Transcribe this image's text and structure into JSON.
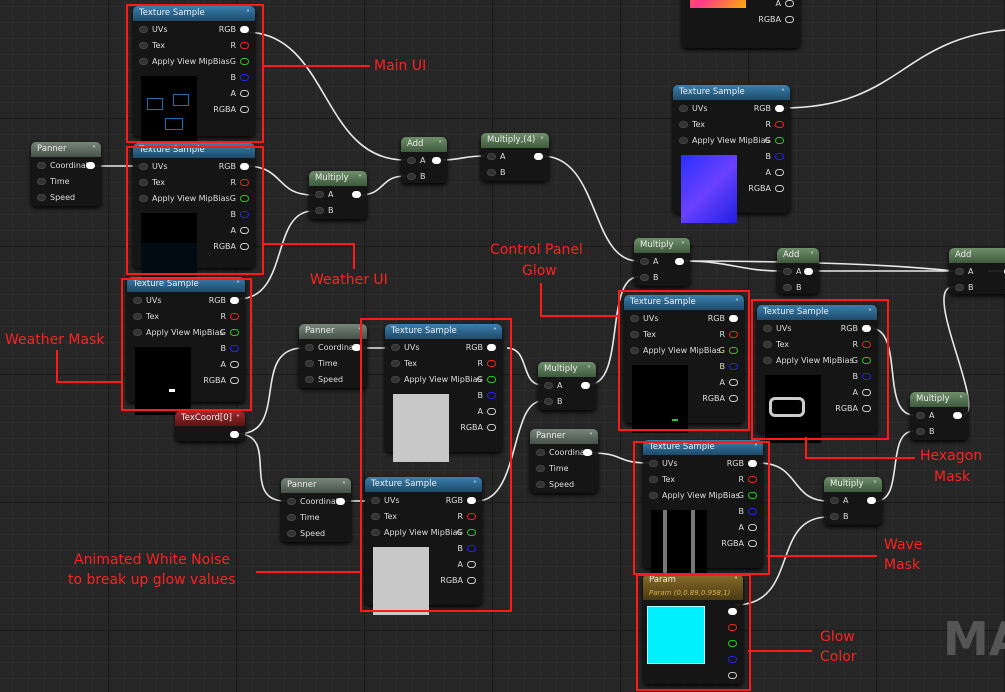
{
  "nodes": [
    {
      "title": "Texture Sample",
      "kind": "tex",
      "inputs": [
        "UVs",
        "Tex",
        "Apply View MipBias"
      ],
      "outputs": [
        "RGB",
        "R",
        "G",
        "B",
        "A",
        "RGBA"
      ],
      "preview": "ui-icons-blue"
    },
    {
      "title": "Texture Sample",
      "kind": "tex",
      "inputs": [
        "UVs",
        "Tex",
        "Apply View MipBias"
      ],
      "outputs": [
        "RGB",
        "R",
        "G",
        "B",
        "A",
        "RGBA"
      ],
      "preview": "dark-blue-panel"
    },
    {
      "title": "Texture Sample",
      "kind": "tex",
      "inputs": [
        "UVs",
        "Tex",
        "Apply View MipBias"
      ],
      "outputs": [
        "RGB",
        "R",
        "G",
        "B",
        "A",
        "RGBA"
      ],
      "preview": "black-white-dash"
    },
    {
      "title": "Panner",
      "kind": "pan",
      "inputs": [
        "Coordinate",
        "Time",
        "Speed"
      ],
      "outputs": [
        ""
      ]
    },
    {
      "title": "Add",
      "kind": "math",
      "inputs": [
        "A",
        "B"
      ],
      "outputs": [
        ""
      ]
    },
    {
      "title": "Multiply,(4)",
      "kind": "math",
      "inputs": [
        "A",
        "B"
      ],
      "outputs": [
        ""
      ]
    },
    {
      "title": "Multiply",
      "kind": "math",
      "inputs": [
        "A",
        "B"
      ],
      "outputs": [
        ""
      ]
    },
    {
      "title": "",
      "kind": "tex",
      "inputs": [],
      "outputs": [
        "A",
        "RGBA"
      ],
      "preview": "orange-texture"
    },
    {
      "title": "Texture Sample",
      "kind": "tex",
      "inputs": [
        "UVs",
        "Tex",
        "Apply View MipBias"
      ],
      "outputs": [
        "RGB",
        "R",
        "G",
        "B",
        "A",
        "RGBA"
      ],
      "preview": "blue-normal-map"
    },
    {
      "title": "Multiply",
      "kind": "math",
      "inputs": [
        "A",
        "B"
      ],
      "outputs": [
        ""
      ]
    },
    {
      "title": "Add",
      "kind": "math",
      "inputs": [
        "A",
        "B"
      ],
      "outputs": [
        ""
      ]
    },
    {
      "title": "Add",
      "kind": "math",
      "inputs": [
        "A",
        "B"
      ],
      "outputs": [
        ""
      ]
    },
    {
      "title": "Texture Sample",
      "kind": "tex",
      "inputs": [
        "UVs",
        "Tex",
        "Apply View MipBias"
      ],
      "outputs": [
        "RGB",
        "R",
        "G",
        "B",
        "A",
        "RGBA"
      ],
      "preview": "black-green-dash"
    },
    {
      "title": "Texture Sample",
      "kind": "tex",
      "inputs": [
        "UVs",
        "Tex",
        "Apply View MipBias"
      ],
      "outputs": [
        "RGB",
        "R",
        "G",
        "B",
        "A",
        "RGBA"
      ],
      "preview": "hexagon-outline"
    },
    {
      "title": "Multiply",
      "kind": "math",
      "inputs": [
        "A",
        "B"
      ],
      "outputs": [
        ""
      ]
    },
    {
      "title": "Panner",
      "kind": "pan",
      "inputs": [
        "Coordinate",
        "Time",
        "Speed"
      ],
      "outputs": [
        ""
      ]
    },
    {
      "title": "Texture Sample",
      "kind": "tex",
      "inputs": [
        "UVs",
        "Tex",
        "Apply View MipBias"
      ],
      "outputs": [
        "RGB",
        "R",
        "G",
        "B",
        "A",
        "RGBA"
      ],
      "preview": "light-grey"
    },
    {
      "title": "Multiply",
      "kind": "math",
      "inputs": [
        "A",
        "B"
      ],
      "outputs": [
        ""
      ]
    },
    {
      "title": "TexCoord[0]",
      "kind": "coord",
      "inputs": [],
      "outputs": [
        ""
      ]
    },
    {
      "title": "Panner",
      "kind": "pan",
      "inputs": [
        "Coordinate",
        "Time",
        "Speed"
      ],
      "outputs": [
        ""
      ]
    },
    {
      "title": "Texture Sample",
      "kind": "tex",
      "inputs": [
        "UVs",
        "Tex",
        "Apply View MipBias"
      ],
      "outputs": [
        "RGB",
        "R",
        "G",
        "B",
        "A",
        "RGBA"
      ],
      "preview": "light-grey"
    },
    {
      "title": "Panner",
      "kind": "pan",
      "inputs": [
        "Coordinate",
        "Time",
        "Speed"
      ],
      "outputs": [
        ""
      ]
    },
    {
      "title": "Texture Sample",
      "kind": "tex",
      "inputs": [
        "UVs",
        "Tex",
        "Apply View MipBias"
      ],
      "outputs": [
        "RGB",
        "R",
        "G",
        "B",
        "A",
        "RGBA"
      ],
      "preview": "vertical-bars"
    },
    {
      "title": "Multiply",
      "kind": "math",
      "inputs": [
        "A",
        "B"
      ],
      "outputs": [
        ""
      ]
    },
    {
      "title": "Param",
      "subtitle": "Param (0,0.89,0.958,1)",
      "kind": "param",
      "inputs": [],
      "outputs": [
        "",
        "",
        "",
        "",
        ""
      ],
      "preview": "cyan-swatch",
      "color": "#00f0ff"
    }
  ],
  "annotations": {
    "main_ui": "Main UI",
    "weather_ui": "Weather UI",
    "weather_mask": "Weather Mask",
    "control_panel_glow": [
      "Control Panel",
      "Glow"
    ],
    "hexagon_mask": [
      "Hexagon",
      "Mask"
    ],
    "wave_mask": [
      "Wave",
      "Mask"
    ],
    "glow_color": [
      "Glow",
      "Color"
    ],
    "white_noise": [
      "Animated White Noise",
      "to break up glow values"
    ]
  },
  "watermark": "MA",
  "colors": {
    "annotation": "#ff1a1a",
    "texture_header": "#2f6a95",
    "math_header": "#5a7a56",
    "param_color": "#00f0ff"
  }
}
